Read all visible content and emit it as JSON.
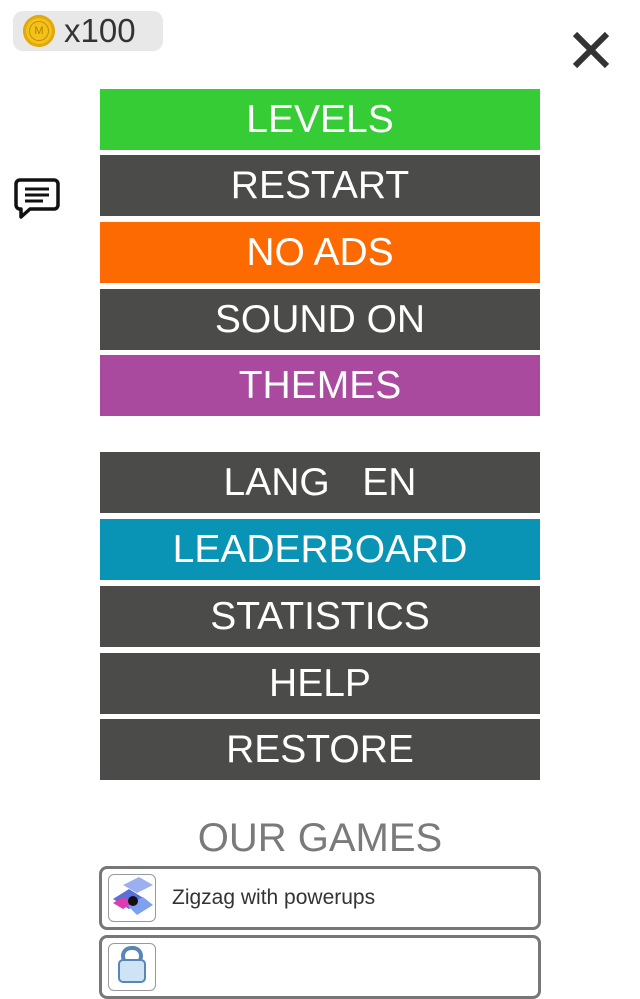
{
  "coins": {
    "count_text": "x100",
    "coin_letter": "M"
  },
  "icons": {
    "close": "close-icon",
    "chat": "chat-icon"
  },
  "menu": [
    {
      "label": "LEVELS",
      "color": "#35cc36"
    },
    {
      "label": "RESTART",
      "color": "#4b4b49"
    },
    {
      "label": "NO ADS",
      "color": "#fd6a02"
    },
    {
      "label": "SOUND ON",
      "color": "#4b4b49"
    },
    {
      "label": "THEMES",
      "color": "#aa4a9f"
    }
  ],
  "menu2": [
    {
      "label": "LANG   EN",
      "color": "#4b4b49"
    },
    {
      "label": "LEADERBOARD",
      "color": "#0994b5"
    },
    {
      "label": "STATISTICS",
      "color": "#4b4b49"
    },
    {
      "label": "HELP",
      "color": "#4b4b49"
    },
    {
      "label": "RESTORE",
      "color": "#4b4b49"
    }
  ],
  "our_games": {
    "heading": "OUR GAMES",
    "items": [
      {
        "title": "Zigzag with powerups",
        "icon": "zigzag-game-icon"
      },
      {
        "title": "",
        "icon": "lock-game-icon"
      }
    ]
  }
}
